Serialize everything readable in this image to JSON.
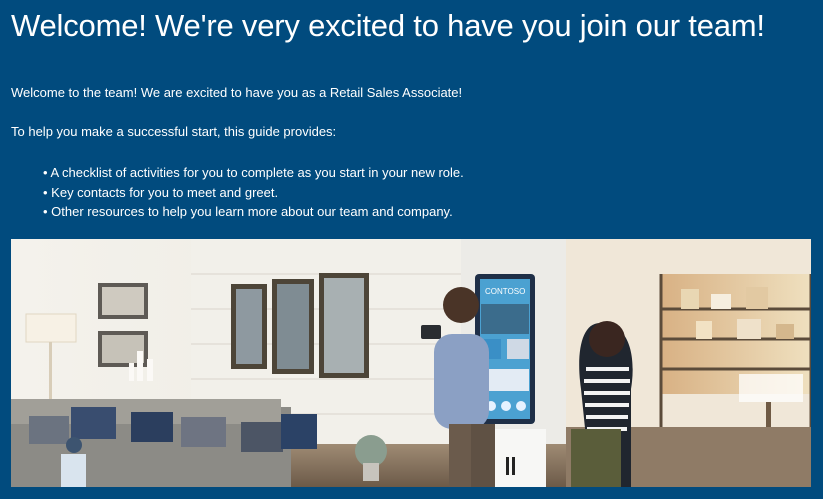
{
  "page": {
    "title": "Welcome! We're very excited to have you join our team!",
    "intro": "Welcome to the team! We are excited to have you as a Retail Sales Associate!",
    "lead": "To help you make a successful start, this guide provides:",
    "bullets": [
      "A checklist of activities for you to complete as you start in your new role.",
      "Key contacts for you to meet and greet.",
      "Other resources to help you learn more about our team and company."
    ]
  },
  "hero_image": {
    "screen_brand": "CONTOSO"
  },
  "colors": {
    "background": "#014b7e",
    "text": "#ffffff"
  }
}
